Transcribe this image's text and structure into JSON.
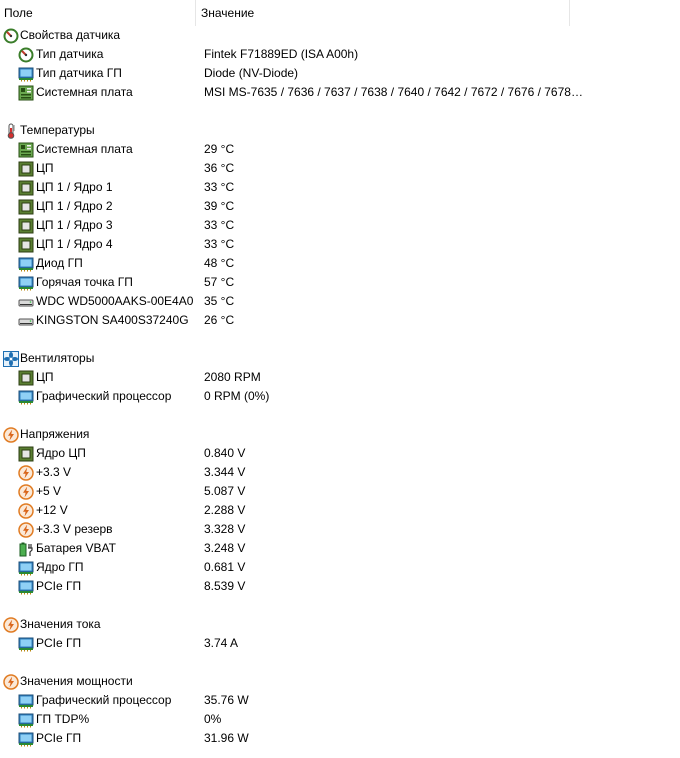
{
  "columns": {
    "field": "Поле",
    "value": "Значение"
  },
  "groups": [
    {
      "label": "Свойства датчика",
      "icon": "gauge-icon",
      "items": [
        {
          "label": "Тип датчика",
          "value": "Fintek F71889ED  (ISA A00h)",
          "icon": "gauge-icon"
        },
        {
          "label": "Тип датчика ГП",
          "value": "Diode  (NV-Diode)",
          "icon": "gpu-icon"
        },
        {
          "label": "Системная плата",
          "value": "MSI MS-7635 / 7636 / 7637 / 7638 / 7640 / 7642 / 7672 / 7676 / 7678…",
          "icon": "motherboard-icon"
        }
      ]
    },
    {
      "label": "Температуры",
      "icon": "thermometer-icon",
      "items": [
        {
          "label": "Системная плата",
          "value": "29 °C",
          "icon": "motherboard-icon"
        },
        {
          "label": "ЦП",
          "value": "36 °C",
          "icon": "cpu-icon"
        },
        {
          "label": "ЦП 1 / Ядро 1",
          "value": "33 °C",
          "icon": "cpu-icon"
        },
        {
          "label": "ЦП 1 / Ядро 2",
          "value": "39 °C",
          "icon": "cpu-icon"
        },
        {
          "label": "ЦП 1 / Ядро 3",
          "value": "33 °C",
          "icon": "cpu-icon"
        },
        {
          "label": "ЦП 1 / Ядро 4",
          "value": "33 °C",
          "icon": "cpu-icon"
        },
        {
          "label": "Диод ГП",
          "value": "48 °C",
          "icon": "gpu-icon"
        },
        {
          "label": "Горячая точка ГП",
          "value": "57 °C",
          "icon": "gpu-icon"
        },
        {
          "label": "WDC WD5000AAKS-00E4A0",
          "value": "35 °C",
          "icon": "hard-drive-icon"
        },
        {
          "label": "KINGSTON SA400S37240G",
          "value": "26 °C",
          "icon": "hard-drive-icon"
        }
      ]
    },
    {
      "label": "Вентиляторы",
      "icon": "fan-icon",
      "items": [
        {
          "label": "ЦП",
          "value": "2080 RPM",
          "icon": "cpu-icon"
        },
        {
          "label": "Графический процессор",
          "value": "0 RPM  (0%)",
          "icon": "gpu-icon"
        }
      ]
    },
    {
      "label": "Напряжения",
      "icon": "lightning-icon",
      "items": [
        {
          "label": "Ядро ЦП",
          "value": "0.840 V",
          "icon": "cpu-icon"
        },
        {
          "label": "+3.3 V",
          "value": "3.344 V",
          "icon": "lightning-icon"
        },
        {
          "label": "+5 V",
          "value": "5.087 V",
          "icon": "lightning-icon"
        },
        {
          "label": "+12 V",
          "value": "2.288 V",
          "icon": "lightning-icon"
        },
        {
          "label": "+3.3 V резерв",
          "value": "3.328 V",
          "icon": "lightning-icon"
        },
        {
          "label": "Батарея VBAT",
          "value": "3.248 V",
          "icon": "battery-icon"
        },
        {
          "label": "Ядро ГП",
          "value": "0.681 V",
          "icon": "gpu-icon"
        },
        {
          "label": "PCIe ГП",
          "value": "8.539 V",
          "icon": "gpu-icon"
        }
      ]
    },
    {
      "label": "Значения тока",
      "icon": "lightning-icon",
      "items": [
        {
          "label": "PCIe ГП",
          "value": "3.74 A",
          "icon": "gpu-icon"
        }
      ]
    },
    {
      "label": "Значения мощности",
      "icon": "lightning-icon",
      "items": [
        {
          "label": "Графический процессор",
          "value": "35.76 W",
          "icon": "gpu-icon"
        },
        {
          "label": "ГП TDP%",
          "value": "0%",
          "icon": "gpu-icon"
        },
        {
          "label": "PCIe ГП",
          "value": "31.96 W",
          "icon": "gpu-icon"
        }
      ]
    }
  ]
}
